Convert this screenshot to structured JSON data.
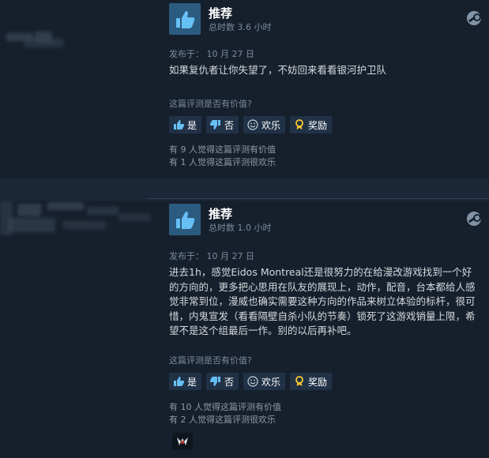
{
  "reviews": [
    {
      "recommendation": "推荐",
      "hours": "总时数 3.6 小时",
      "posted": "发布于：  10 月 27 日",
      "body": "如果复仇者让你失望了，不妨回来看看银河护卫队",
      "helpful_question": "这篇评测是否有价值?",
      "buttons": {
        "yes": "是",
        "no": "否",
        "funny": "欢乐",
        "award": "奖励"
      },
      "votes_helpful": "有 9 人觉得这篇评测有价值",
      "votes_funny": "有 1 人觉得这篇评测很欢乐"
    },
    {
      "recommendation": "推荐",
      "hours": "总时数 1.0 小时",
      "posted": "发布于：  10 月 27 日",
      "body": "进去1h，感觉Eidos Montreal还是很努力的在给漫改游戏找到一个好的方向的，更多把心思用在队友的展现上，动作，配音，台本都给人感觉非常到位，漫威也确实需要这种方向的作品来树立体验的标杆，很可惜，内鬼宣发（看看隔壁自杀小队的节奏）锁死了这游戏销量上限，希望不是这个组最后一作。别的以后再补吧。",
      "helpful_question": "这篇评测是否有价值?",
      "buttons": {
        "yes": "是",
        "no": "否",
        "funny": "欢乐",
        "award": "奖励"
      },
      "votes_helpful": "有 10 人觉得这篇评测有价值",
      "votes_funny": "有 2 人觉得这篇评测很欢乐"
    }
  ],
  "icons": {
    "recommend": "thumbs-up-icon",
    "platform": "steam-icon",
    "yes": "thumbs-up-icon",
    "no": "thumbs-down-icon",
    "funny": "smiley-icon",
    "award": "award-icon",
    "received_award": "award-badge-icon"
  },
  "colors": {
    "background": "#1b2838",
    "review_bg": "#16202d",
    "thumb_box": "#2c5b80",
    "thumb": "#66c0f4",
    "button_bg": "#213247",
    "award": "#ffc82c"
  }
}
